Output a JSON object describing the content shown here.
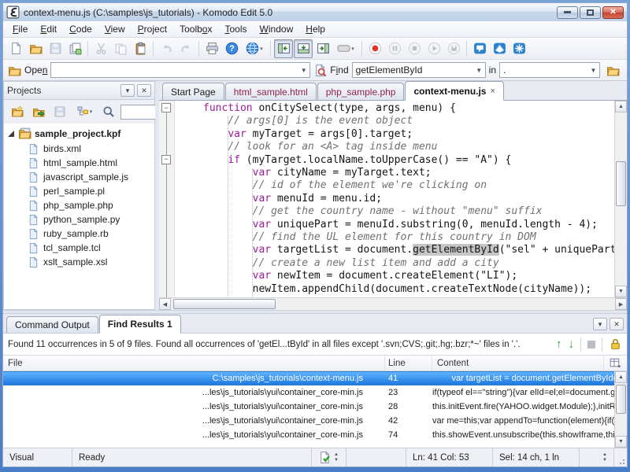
{
  "window": {
    "title": "context-menu.js (C:\\samples\\js_tutorials) - Komodo Edit 5.0"
  },
  "menu": {
    "items": [
      {
        "label": "File",
        "accel": 0
      },
      {
        "label": "Edit",
        "accel": 0
      },
      {
        "label": "Code",
        "accel": 0
      },
      {
        "label": "View",
        "accel": 0
      },
      {
        "label": "Project",
        "accel": 0
      },
      {
        "label": "Toolbox",
        "accel": 5
      },
      {
        "label": "Tools",
        "accel": 0
      },
      {
        "label": "Window",
        "accel": 0
      },
      {
        "label": "Help",
        "accel": 0
      }
    ]
  },
  "main_toolbar": [
    {
      "icon": "new-file"
    },
    {
      "icon": "open-folder"
    },
    {
      "icon": "save",
      "disabled": true
    },
    {
      "icon": "save-all"
    },
    {
      "sep": true
    },
    {
      "icon": "cut",
      "disabled": true
    },
    {
      "icon": "copy",
      "disabled": true
    },
    {
      "icon": "paste"
    },
    {
      "sep": true
    },
    {
      "icon": "undo",
      "disabled": true
    },
    {
      "icon": "redo",
      "disabled": true
    },
    {
      "sep": true
    },
    {
      "icon": "print"
    },
    {
      "icon": "help"
    },
    {
      "icon": "browser",
      "dropdown": true
    },
    {
      "sep": true
    },
    {
      "icon": "pane-left",
      "pressed": true
    },
    {
      "icon": "pane-bottom",
      "pressed": true
    },
    {
      "icon": "pane-right"
    },
    {
      "icon": "preview",
      "dropdown": true
    },
    {
      "sep": true
    },
    {
      "icon": "macro-record"
    },
    {
      "icon": "macro-pause",
      "disabled": true
    },
    {
      "icon": "macro-stop",
      "disabled": true
    },
    {
      "icon": "macro-play",
      "disabled": true
    },
    {
      "icon": "macro-save",
      "disabled": true
    },
    {
      "sep": true
    },
    {
      "icon": "komodo-bubble"
    },
    {
      "icon": "komodo-web"
    },
    {
      "icon": "komodo-tools"
    }
  ],
  "openbar": {
    "open_label": "Open",
    "open_accel": 3,
    "open_value": "",
    "find_label": "Find",
    "find_accel": 1,
    "find_value": "getElementById",
    "in_label": "in",
    "in_value": "."
  },
  "projects": {
    "title": "Projects",
    "toolbar": [
      {
        "icon": "folder-new"
      },
      {
        "icon": "folder-import"
      },
      {
        "icon": "save",
        "disabled": true
      },
      {
        "icon": "project-view",
        "dropdown": true
      },
      {
        "icon": "magnifier"
      }
    ],
    "root": "sample_project.kpf",
    "files": [
      "birds.xml",
      "html_sample.html",
      "javascript_sample.js",
      "perl_sample.pl",
      "php_sample.php",
      "python_sample.py",
      "ruby_sample.rb",
      "tcl_sample.tcl",
      "xslt_sample.xsl"
    ]
  },
  "editor": {
    "tabs": [
      {
        "label": "Start Page"
      },
      {
        "label": "html_sample.html",
        "modified": true
      },
      {
        "label": "php_sample.php",
        "modified": true
      },
      {
        "label": "context-menu.js",
        "active": true,
        "closable": true
      }
    ],
    "close_glyph": "×",
    "fold_lines": [
      0,
      4
    ],
    "lines": [
      [
        [
          "k",
          "function"
        ],
        [
          "p",
          " onCitySelect(type, args, menu) {"
        ]
      ],
      [
        [
          "p",
          "    "
        ],
        [
          "c",
          "// args[0] is the event object"
        ]
      ],
      [
        [
          "p",
          "    "
        ],
        [
          "k",
          "var"
        ],
        [
          "p",
          " myTarget = args[0].target;"
        ]
      ],
      [
        [
          "p",
          "    "
        ],
        [
          "c",
          "// look for an <A> tag inside menu"
        ]
      ],
      [
        [
          "p",
          "    "
        ],
        [
          "k",
          "if"
        ],
        [
          "p",
          " (myTarget.localName.toUpperCase() == \"A\") {"
        ]
      ],
      [
        [
          "p",
          "        "
        ],
        [
          "k",
          "var"
        ],
        [
          "p",
          " cityName = myTarget.text;"
        ]
      ],
      [
        [
          "p",
          "        "
        ],
        [
          "c",
          "// id of the element we're clicking on"
        ]
      ],
      [
        [
          "p",
          "        "
        ],
        [
          "k",
          "var"
        ],
        [
          "p",
          " menuId = menu.id;"
        ]
      ],
      [
        [
          "p",
          "        "
        ],
        [
          "c",
          "// get the country name - without \"menu\" suffix"
        ]
      ],
      [
        [
          "p",
          "        "
        ],
        [
          "k",
          "var"
        ],
        [
          "p",
          " uniquePart = menuId.substring(0, menuId.length - 4);"
        ]
      ],
      [
        [
          "p",
          "        "
        ],
        [
          "c",
          "// find the UL element for this country in DOM"
        ]
      ],
      [
        [
          "p",
          "        "
        ],
        [
          "k",
          "var"
        ],
        [
          "p",
          " targetList = document."
        ],
        [
          "h",
          "getElementById"
        ],
        [
          "p",
          "(\"sel\" + uniquePart);"
        ]
      ],
      [
        [
          "p",
          "        "
        ],
        [
          "c",
          "// create a new list item and add a city"
        ]
      ],
      [
        [
          "p",
          "        "
        ],
        [
          "k",
          "var"
        ],
        [
          "p",
          " newItem = document.createElement(\"LI\");"
        ]
      ],
      [
        [
          "p",
          "        newItem.appendChild(document.createTextNode(cityName));"
        ]
      ]
    ]
  },
  "bottom": {
    "tabs": [
      {
        "label": "Command Output"
      },
      {
        "label": "Find Results 1",
        "active": true
      }
    ],
    "message": "Found 11 occurrences in 5 of 9 files. Found all occurrences of 'getEl...tById' in all files except '.svn;CVS;.git;.hg;.bzr;*~' files in '.'.",
    "table": {
      "headers": [
        "File",
        "Line",
        "Content"
      ],
      "rows": [
        {
          "file": "C:\\samples\\js_tutorials\\context-menu.js",
          "line": "41",
          "content": "        var targetList = document.getElementById(\"sel\" + uniquePart);",
          "selected": true
        },
        {
          "file": "...les\\js_tutorials\\yui\\container_core-min.js",
          "line": "23",
          "content": "if(typeof el==\"string\"){var elId=el;el=document.getElementById(el);if(!el){el=document...."
        },
        {
          "file": "...les\\js_tutorials\\yui\\container_core-min.js",
          "line": "28",
          "content": "this.initEvent.fire(YAHOO.widget.Module);},initResizeMonitor:function(){if(this.browser!..."
        },
        {
          "file": "...les\\js_tutorials\\yui\\container_core-min.js",
          "line": "42",
          "content": "var me=this;var appendTo=function(element){if(typeof element==\"string\"){element=d..."
        },
        {
          "file": "...les\\js_tutorials\\yui\\container_core-min.js",
          "line": "74",
          "content": "this.showEvent.unsubscribe(this.showIframe,this);this.hideEvent.unsubscribe(this.hideIfr..."
        }
      ]
    }
  },
  "statusbar": {
    "mode": "Visual",
    "message": "Ready",
    "line_col": "Ln: 41 Col: 53",
    "selection": "Sel: 14 ch, 1 ln"
  },
  "icons_legend": {
    "komodo-app": "app logo swirl",
    "new-file": "blank page",
    "open-folder": "yellow folder",
    "save": "floppy disk",
    "save-all": "stacked pages",
    "cut": "scissors",
    "copy": "two pages",
    "paste": "clipboard",
    "undo": "curved arrow left",
    "redo": "curved arrow right",
    "print": "printer",
    "help": "blue ? circle",
    "browser": "globe",
    "pane-left": "toggle left pane",
    "pane-bottom": "toggle bottom pane",
    "pane-right": "toggle right pane",
    "preview": "preview box",
    "macro-record": "red dot",
    "macro-pause": "pause",
    "macro-stop": "stop",
    "macro-play": "play",
    "macro-save": "save macro",
    "komodo-bubble": "feedback bubble",
    "komodo-web": "komodo web",
    "komodo-tools": "komodo tools",
    "folder-new": "new project",
    "folder-import": "import folder",
    "project-view": "view config",
    "magnifier": "search",
    "find-doc": "find in document",
    "file": "file page",
    "folder-open-orange": "open project folder",
    "lock": "lock results",
    "page-check": "syntax ok",
    "col-picker": "column picker"
  },
  "colors": {
    "keyword": "#9b1b9b",
    "comment": "#707070",
    "modified_tab": "#8b2252",
    "selection_row": "#1e79e0",
    "find_highlight": "#c6c6c6",
    "frame": "#4a7dc8"
  }
}
